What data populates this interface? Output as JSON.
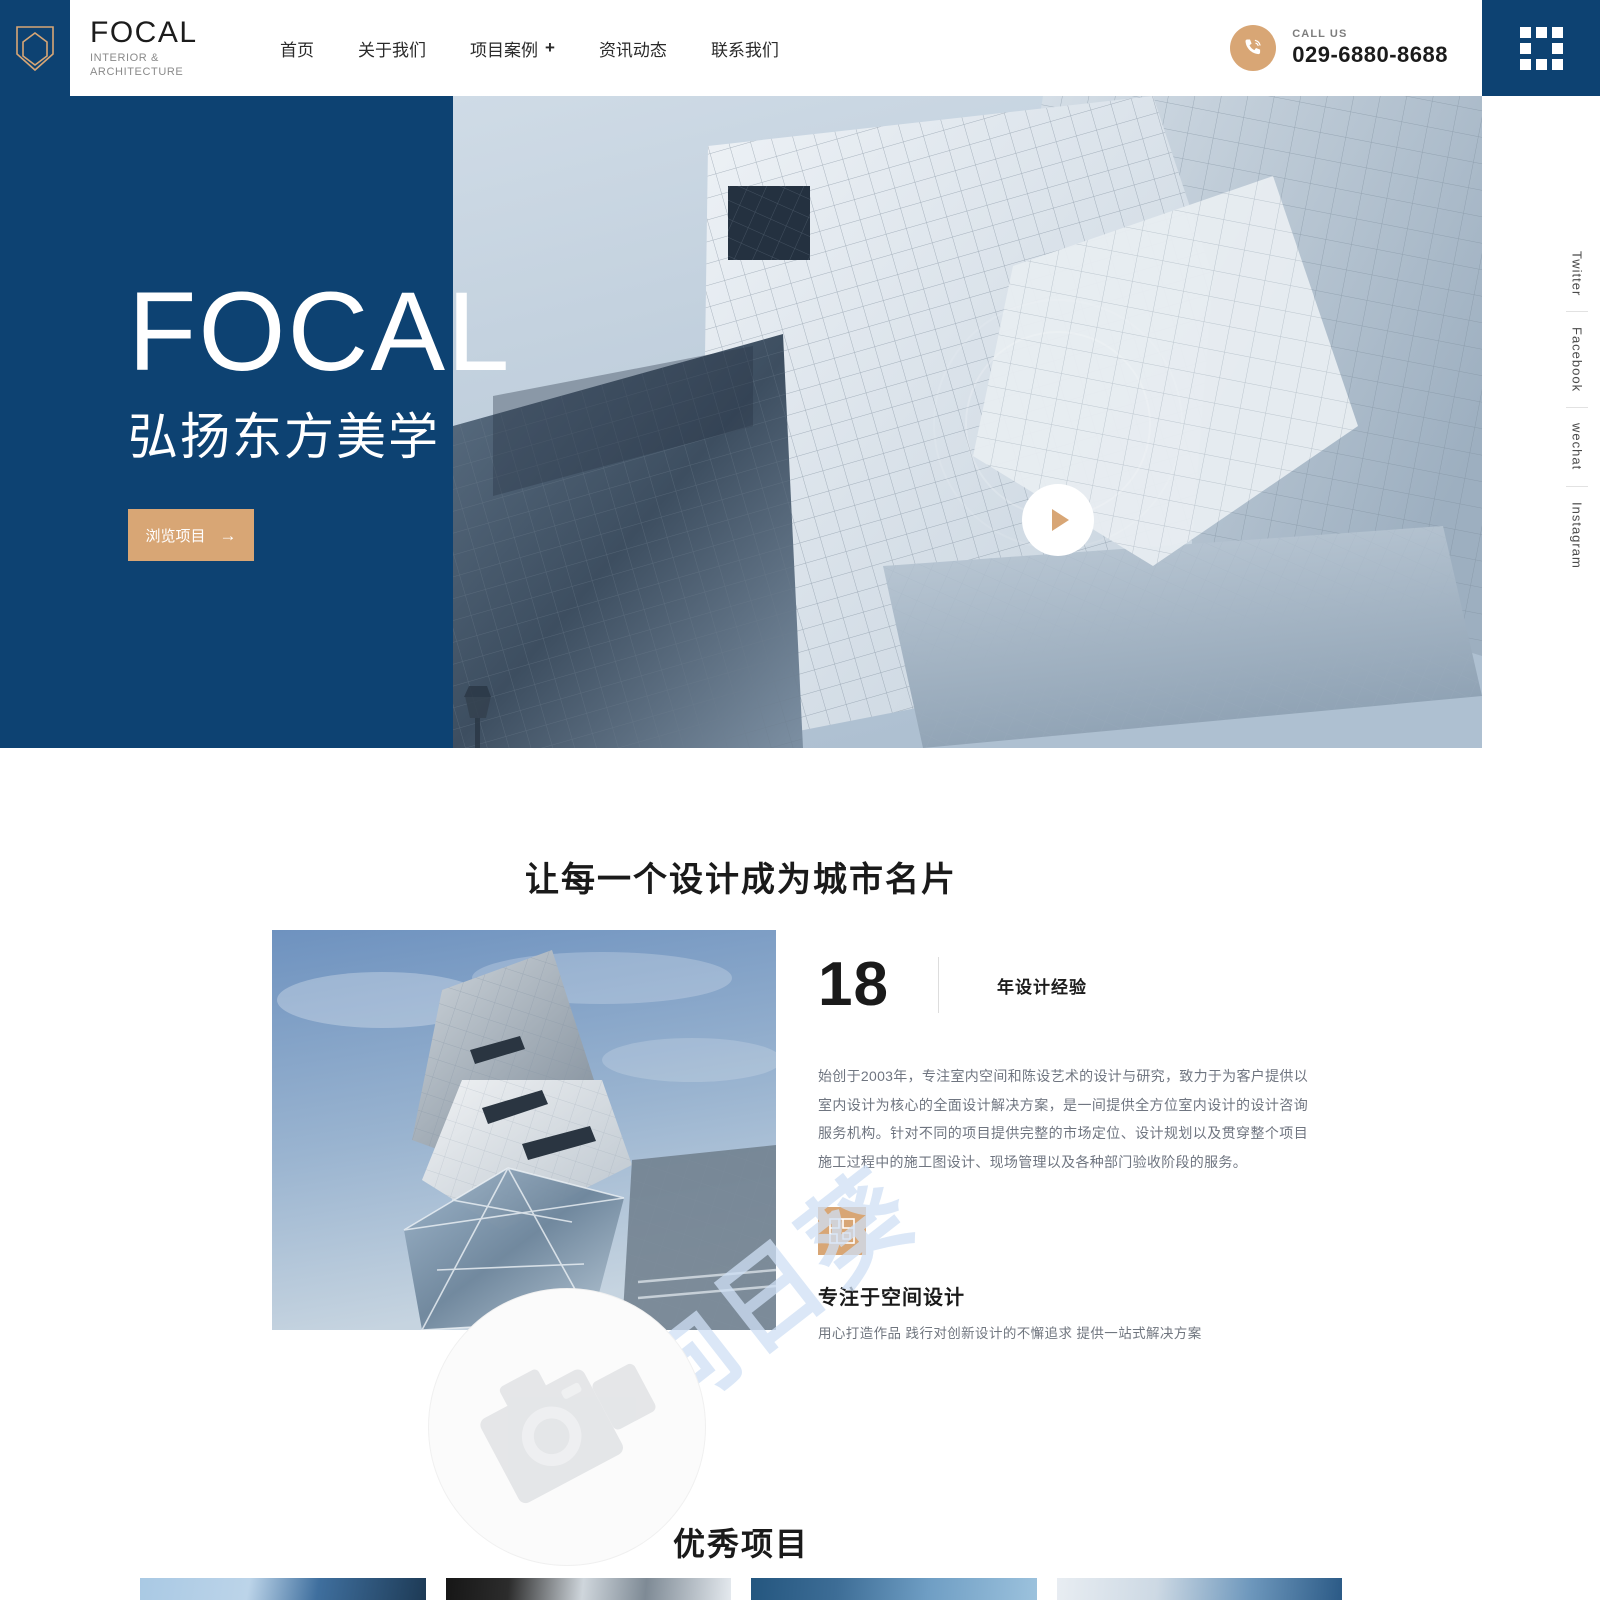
{
  "header": {
    "logo": {
      "icon": "shield-hexagon-icon",
      "word": "FOCAL",
      "sub_line1": "INTERIOR &",
      "sub_line2": "ARCHITECTURE"
    },
    "nav": [
      {
        "label": "首页",
        "has_plus": false
      },
      {
        "label": "关于我们",
        "has_plus": false
      },
      {
        "label": "项目案例",
        "has_plus": true,
        "plus": "+"
      },
      {
        "label": "资讯动态",
        "has_plus": false
      },
      {
        "label": "联系我们",
        "has_plus": false
      }
    ],
    "call": {
      "icon": "phone-icon",
      "label": "CALL US",
      "number": "029-6880-8688"
    },
    "grid_menu_icon": "grid-menu-icon"
  },
  "hero": {
    "title": "FOCAL",
    "subtitle": "弘扬东方美学",
    "button_label": "浏览项目",
    "button_arrow": "→",
    "play_icon": "play-icon"
  },
  "social": [
    {
      "label": "Twitter"
    },
    {
      "label": "Facebook"
    },
    {
      "label": "wechat"
    },
    {
      "label": "Instagram"
    }
  ],
  "about": {
    "section_title": "让每一个设计成为城市名片",
    "stat_number": "18",
    "stat_label": "年设计经验",
    "paragraph": "始创于2003年，专注室内空间和陈设艺术的设计与研究，致力于为客户提供以室内设计为核心的全面设计解决方案，是一间提供全方位室内设计的设计咨询服务机构。针对不同的项目提供完整的市场定位、设计规划以及贯穿整个项目施工过程中的施工图设计、现场管理以及各种部门验收阶段的服务。",
    "feature_icon": "floor-plan-icon",
    "feature_title": "专注于空间设计",
    "feature_subtitle": "用心打造作品 践行对创新设计的不懈追求 提供一站式解决方案"
  },
  "watermark": {
    "text": "向日葵",
    "circle_icon": "camera-watermark-icon"
  },
  "projects": {
    "section_title": "优秀项目",
    "cards": [
      {
        "name": "project-card-1"
      },
      {
        "name": "project-card-2"
      },
      {
        "name": "project-card-3"
      },
      {
        "name": "project-card-4"
      }
    ]
  },
  "colors": {
    "brand_navy": "#0d4272",
    "accent_tan": "#d8a675",
    "text_dark": "#1a1a1a",
    "text_muted": "#6f7580"
  }
}
